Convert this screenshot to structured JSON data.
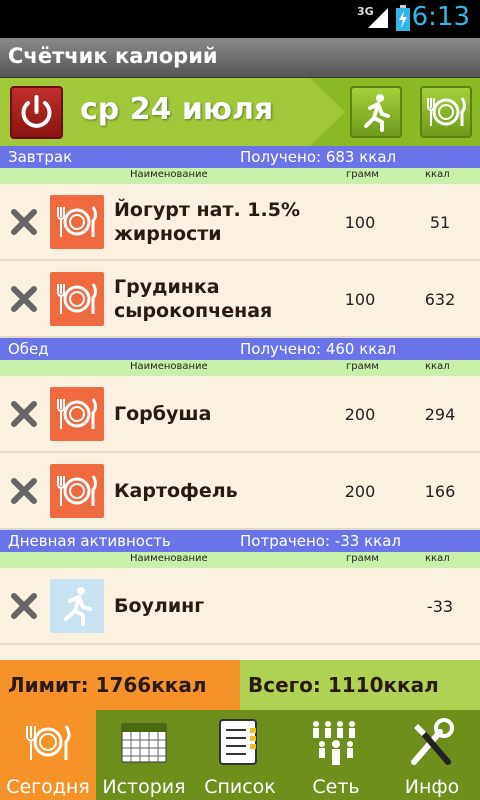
{
  "status": {
    "network": "3G",
    "time": "6:13"
  },
  "app": {
    "title": "Счётчик калорий"
  },
  "date": {
    "label": "ср 24 июля"
  },
  "columns": {
    "name": "Наименование",
    "gram": "грамм",
    "kcal": "ккал"
  },
  "sections": [
    {
      "name": "Завтрак",
      "summary": "Получено: 683 ккал",
      "items": [
        {
          "name": "Йогурт нат. 1.5% жирности",
          "gram": "100",
          "kcal": "51",
          "icon": "plate-icon"
        },
        {
          "name": "Грудинка сырокопченая",
          "gram": "100",
          "kcal": "632",
          "icon": "plate-icon"
        }
      ]
    },
    {
      "name": "Обед",
      "summary": "Получено: 460 ккал",
      "items": [
        {
          "name": "Горбуша",
          "gram": "200",
          "kcal": "294",
          "icon": "plate-icon"
        },
        {
          "name": "Картофель",
          "gram": "200",
          "kcal": "166",
          "icon": "plate-icon"
        }
      ]
    },
    {
      "name": "Дневная активность",
      "summary": "Потрачено: -33 ккал",
      "items": [
        {
          "name": "Боулинг",
          "gram": "",
          "kcal": "-33",
          "icon": "runner-icon"
        }
      ]
    }
  ],
  "totals": {
    "limit": "Лимит:  1766ккал",
    "total": "Всего:  1110ккал"
  },
  "tabs": [
    {
      "label": "Сегодня",
      "icon": "plate-icon",
      "active": true
    },
    {
      "label": "История",
      "icon": "calendar-icon",
      "active": false
    },
    {
      "label": "Список",
      "icon": "list-icon",
      "active": false
    },
    {
      "label": "Сеть",
      "icon": "people-icon",
      "active": false
    },
    {
      "label": "Инфо",
      "icon": "tools-icon",
      "active": false
    }
  ],
  "colors": {
    "accent_green": "#8bb825",
    "section_blue": "#6a74e8",
    "limit_orange": "#f5922a",
    "food_icon_red": "#f06a40"
  }
}
